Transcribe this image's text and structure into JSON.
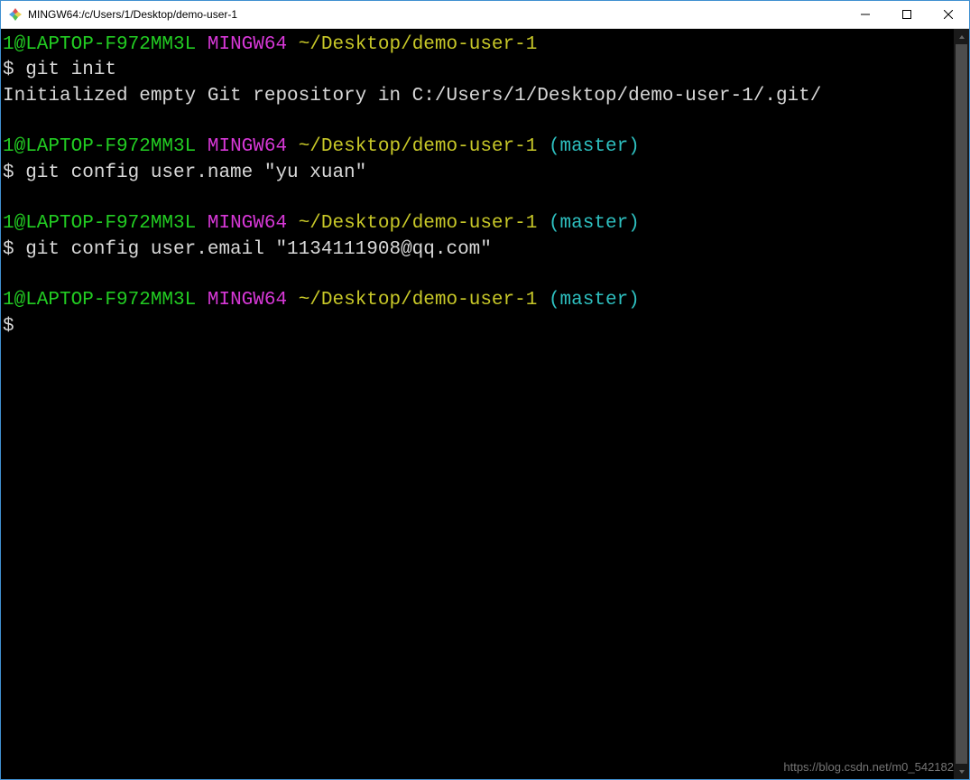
{
  "window": {
    "title": "MINGW64:/c/Users/1/Desktop/demo-user-1"
  },
  "terminal": {
    "blocks": [
      {
        "prompt": {
          "user_host": "1@LAPTOP-F972MM3L",
          "env": "MINGW64",
          "path": "~/Desktop/demo-user-1",
          "branch": ""
        },
        "command": "git init",
        "output": "Initialized empty Git repository in C:/Users/1/Desktop/demo-user-1/.git/"
      },
      {
        "prompt": {
          "user_host": "1@LAPTOP-F972MM3L",
          "env": "MINGW64",
          "path": "~/Desktop/demo-user-1",
          "branch": "(master)"
        },
        "command": "git config user.name \"yu xuan\"",
        "output": ""
      },
      {
        "prompt": {
          "user_host": "1@LAPTOP-F972MM3L",
          "env": "MINGW64",
          "path": "~/Desktop/demo-user-1",
          "branch": "(master)"
        },
        "command": "git config user.email \"1134111908@qq.com\"",
        "output": ""
      },
      {
        "prompt": {
          "user_host": "1@LAPTOP-F972MM3L",
          "env": "MINGW64",
          "path": "~/Desktop/demo-user-1",
          "branch": "(master)"
        },
        "command": "",
        "output": ""
      }
    ],
    "prompt_symbol": "$"
  },
  "watermark": "https://blog.csdn.net/m0_542182"
}
